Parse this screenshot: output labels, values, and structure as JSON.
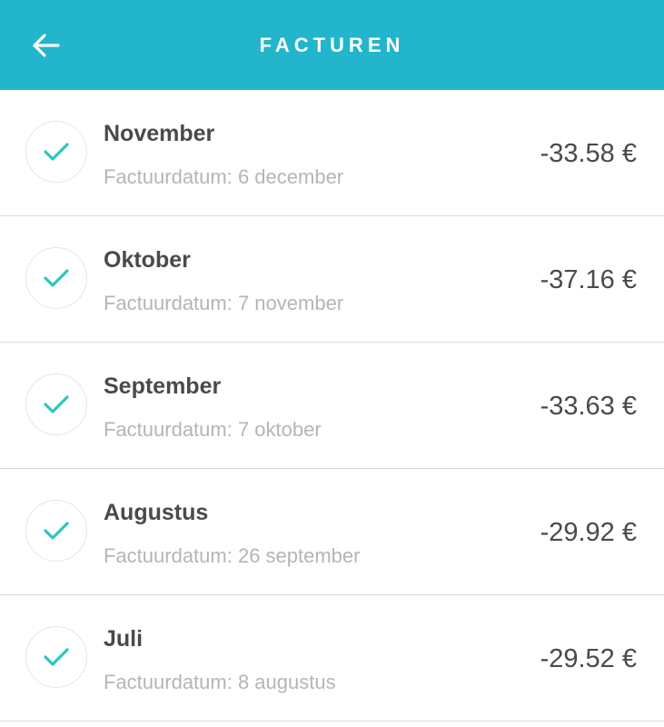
{
  "header": {
    "title": "FACTUREN",
    "back_icon": "arrow-left-icon",
    "background_color": "#22b5cb"
  },
  "invoices": [
    {
      "month": "November",
      "date_label": "Factuurdatum: 6 december",
      "amount": "-33.58 €",
      "status_icon": "check-icon"
    },
    {
      "month": "Oktober",
      "date_label": "Factuurdatum: 7 november",
      "amount": "-37.16 €",
      "status_icon": "check-icon"
    },
    {
      "month": "September",
      "date_label": "Factuurdatum: 7 oktober",
      "amount": "-33.63 €",
      "status_icon": "check-icon"
    },
    {
      "month": "Augustus",
      "date_label": "Factuurdatum: 26 september",
      "amount": "-29.92 €",
      "status_icon": "check-icon"
    },
    {
      "month": "Juli",
      "date_label": "Factuurdatum: 8 augustus",
      "amount": "-29.52 €",
      "status_icon": "check-icon"
    }
  ],
  "colors": {
    "accent": "#22b5cb",
    "check": "#2cc7be",
    "text_primary": "#4a4a4a",
    "text_secondary": "#b5b5b5"
  }
}
